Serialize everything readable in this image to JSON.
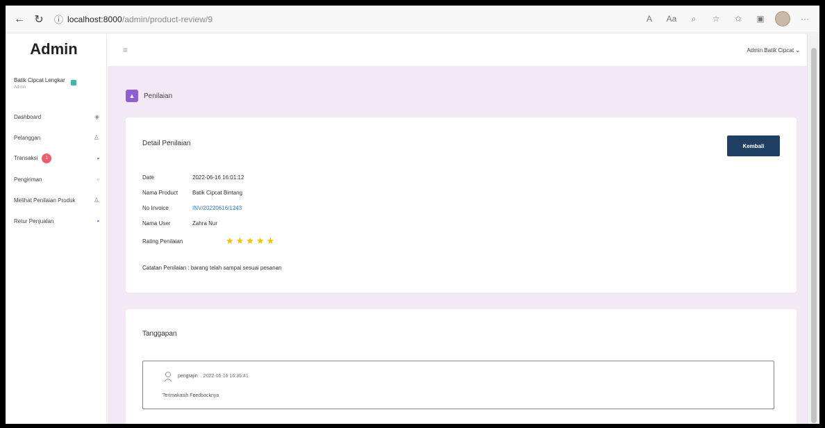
{
  "browser": {
    "url_host": "localhost:8000",
    "url_path": "/admin/product-review/9"
  },
  "sidebar": {
    "brand": "Admin",
    "profile_name": "Batik Cipcat Lengkar",
    "profile_role": "Admin",
    "items": [
      {
        "label": "Dashboard",
        "icon": "dashboard-icon"
      },
      {
        "label": "Pelanggan",
        "icon": "users-icon"
      },
      {
        "label": "Transaksi",
        "icon": "cart-icon",
        "badge": "1"
      },
      {
        "label": "Pengiriman",
        "icon": "truck-icon"
      },
      {
        "label": "Melihat Penilaian Produk",
        "icon": "review-icon"
      },
      {
        "label": "Retur Penjualan",
        "icon": "return-icon"
      }
    ]
  },
  "topbar": {
    "user": "Admin Batik Cipcat"
  },
  "page": {
    "title": "Penilaian"
  },
  "detail": {
    "title": "Detail Penilaian",
    "back_label": "Kembali",
    "rows": [
      {
        "label": "Date",
        "value": "2022-06-16 16:01:12"
      },
      {
        "label": "Nama Product",
        "value": "Batik Cipcat Bintang"
      },
      {
        "label": "No Invoice",
        "value": "INV/20220616/1243"
      },
      {
        "label": "Nama User",
        "value": "Zahra Nur"
      }
    ],
    "rating_label": "Rating Penilaian",
    "rating_value": 5,
    "stars": "★★★★★",
    "note_label": "Catatan Penilaian :",
    "note_value": "barang telah sampai sesuai pesanan"
  },
  "reply": {
    "title": "Tanggapan",
    "author": "pengrajin",
    "date": "2022-06-16 16:36:41",
    "text": "Terimakasih Feedbacknya"
  },
  "colors": {
    "content_bg": "#f3e9f6",
    "accent_purple": "#8e5fd0",
    "button_navy": "#1f3f63",
    "star_gold": "#f2c200",
    "badge_red": "#ef5a6f",
    "link_blue": "#3a78c9"
  }
}
